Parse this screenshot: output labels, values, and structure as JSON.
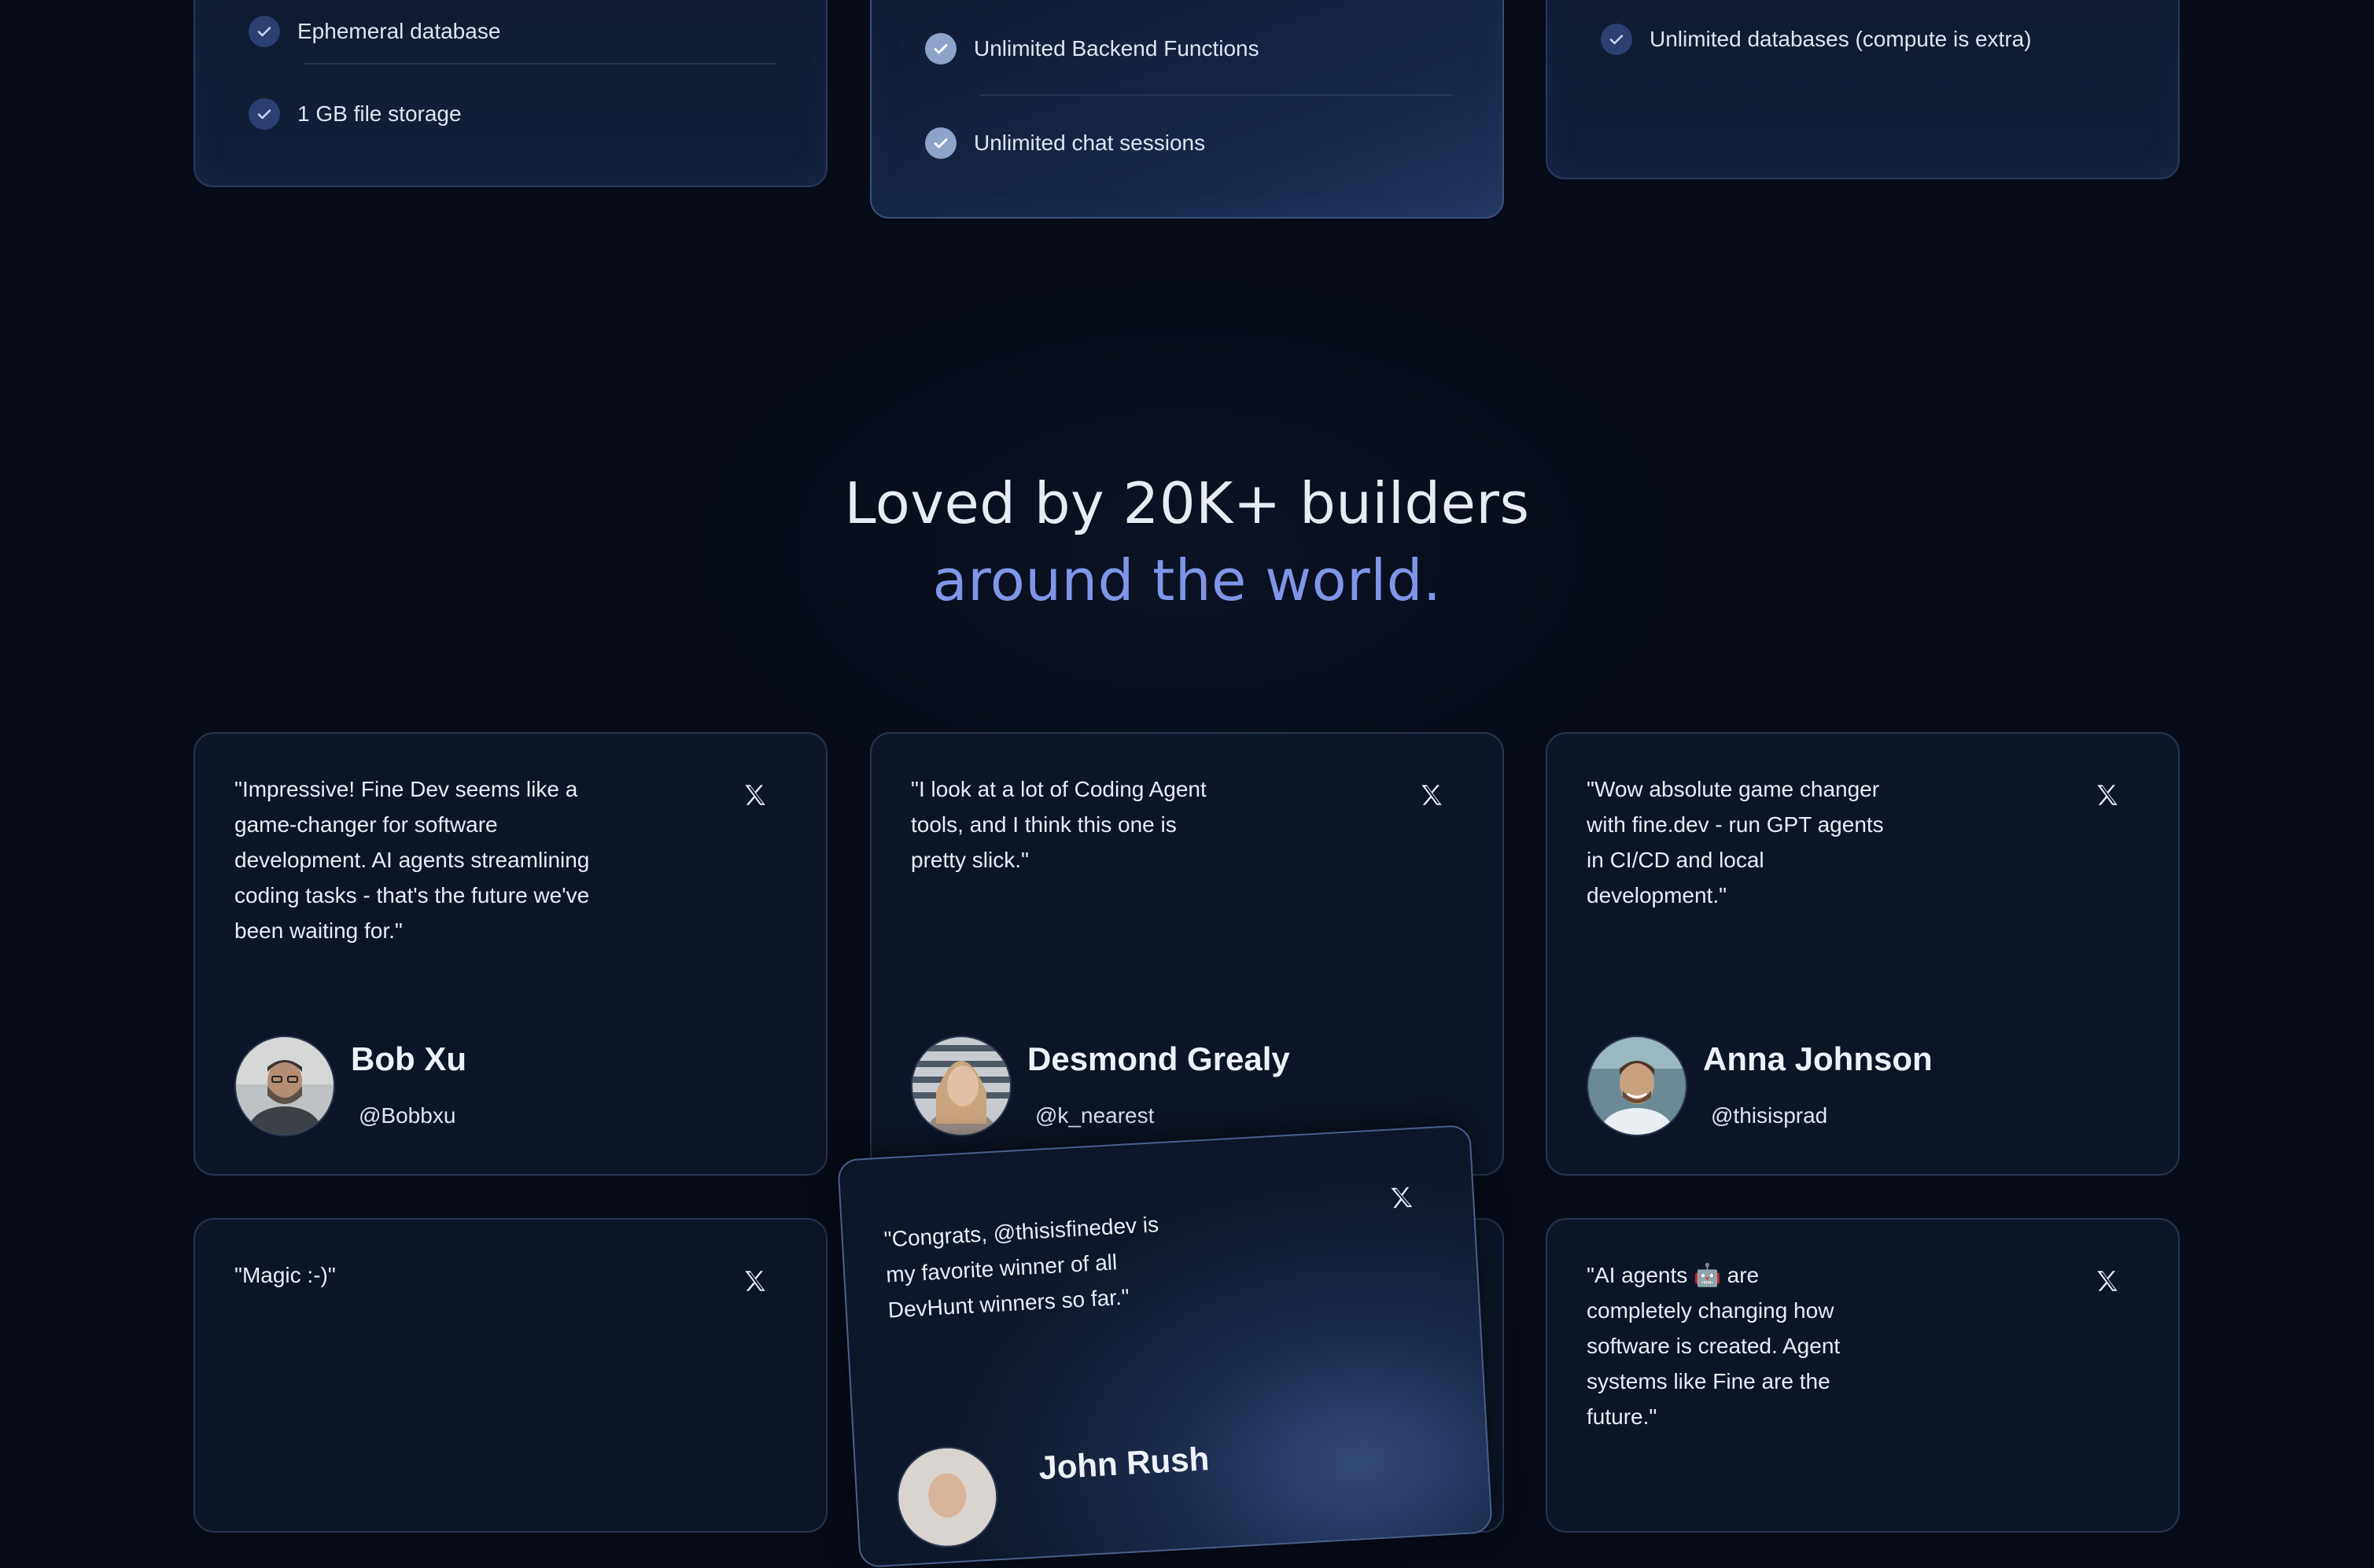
{
  "pricing": {
    "left": {
      "features": [
        "Ephemeral database",
        "1 GB file storage"
      ]
    },
    "middle": {
      "features": [
        "Unlimited Backend Functions",
        "Unlimited chat sessions"
      ]
    },
    "right": {
      "features": [
        "Unlimited databases (compute is extra)"
      ]
    }
  },
  "section": {
    "heading_line1": "Loved by 20K+ builders",
    "heading_line2": "around the world.",
    "accent_color": "#7f96e8"
  },
  "testimonials": [
    {
      "quote": "\"Impressive! Fine Dev seems like a game-changer for software development. AI agents streamlining coding tasks - that's the future we've been waiting for.\"",
      "name": "Bob Xu",
      "handle": "@Bobbxu",
      "icon": "x-logo-icon"
    },
    {
      "quote": "\"I look at a lot of Coding Agent tools, and I think this one is pretty slick.\"",
      "name": "Desmond Grealy",
      "handle": "@k_nearest",
      "icon": "x-logo-icon"
    },
    {
      "quote": "\"Wow absolute game changer with fine.dev - run GPT agents in CI/CD and local development.\"",
      "name": "Anna Johnson",
      "handle": "@thisisprad",
      "icon": "x-logo-icon"
    },
    {
      "quote": "\"Magic :-)\"",
      "icon": "x-logo-icon"
    },
    {
      "quote": "\"Congrats, @thisisfinedev is my favorite winner of all DevHunt winners so far.\"",
      "name": "John Rush",
      "icon": "x-logo-icon"
    },
    {
      "quote": "\"AI agents 🤖 are completely changing how software is created. Agent systems like Fine are the future.\"",
      "icon": "x-logo-icon"
    }
  ]
}
